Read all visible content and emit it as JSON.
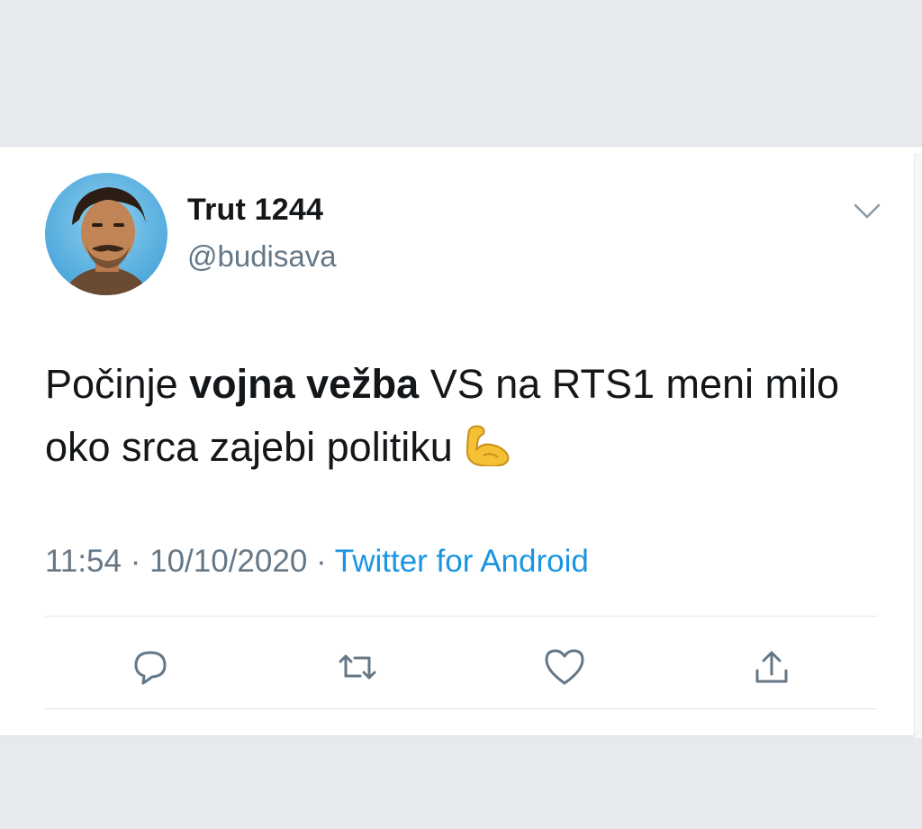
{
  "tweet": {
    "display_name": "Trut 1244",
    "handle": "@budisava",
    "text_part1": "Počinje ",
    "text_bold": "vojna vežba",
    "text_part2": " VS na RTS1 meni milo oko srca zajebi politiku ",
    "emoji": "flexed-biceps",
    "time": "11:54",
    "date": "10/10/2020",
    "separator": " · ",
    "source": "Twitter for Android"
  },
  "actions": {
    "reply_icon": "reply-icon",
    "retweet_icon": "retweet-icon",
    "like_icon": "heart-icon",
    "share_icon": "share-icon"
  },
  "colors": {
    "page_background": "#e6e9ed",
    "card_background": "#ffffff",
    "text_primary": "#14171a",
    "text_secondary": "#657786",
    "link": "#1b95e0"
  }
}
